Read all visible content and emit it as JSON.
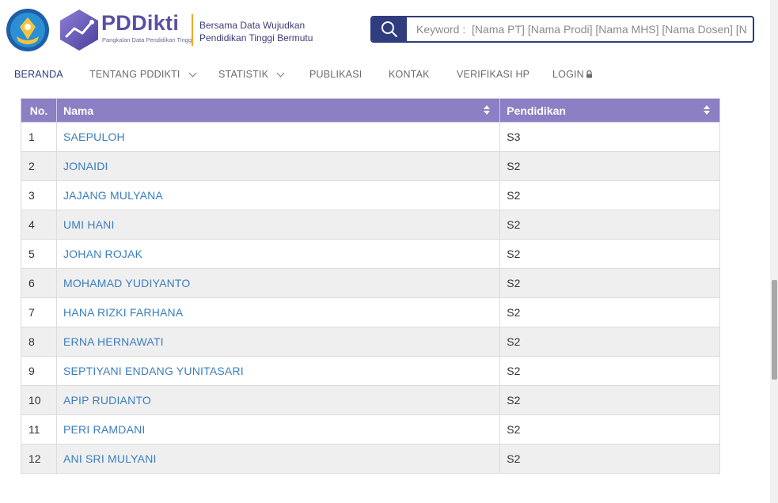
{
  "header": {
    "brand_name": "PDDikti",
    "brand_sub": "Pangkalan Data Pendidikan Tinggi",
    "tagline_line1": "Bersama Data Wujudkan",
    "tagline_line2": "Pendidikan Tinggi Bermutu",
    "search_placeholder": "Keyword :  [Nama PT] [Nama Prodi] [Nama MHS] [Nama Dosen] [N",
    "colors": {
      "brand": "#5a4fa6",
      "search_border": "#2f3c7e",
      "accent": "#f5a623"
    }
  },
  "nav": {
    "items": [
      {
        "label": "BERANDA",
        "icon": null
      },
      {
        "label": "TENTANG PDDIKTI",
        "icon": "chevron-down-icon"
      },
      {
        "label": "STATISTIK",
        "icon": "chevron-down-icon"
      },
      {
        "label": "PUBLIKASI",
        "icon": null
      },
      {
        "label": "KONTAK",
        "icon": null
      },
      {
        "label": "VERIFIKASI HP",
        "icon": null
      },
      {
        "label": "LOGIN",
        "icon": "lock-icon"
      }
    ],
    "active": "BERANDA"
  },
  "table": {
    "headers": {
      "no": "No.",
      "nama": "Nama",
      "pendidikan": "Pendidikan"
    },
    "header_color": "#8c7fc3",
    "link_color": "#3a7ebf",
    "rows": [
      {
        "no": "1",
        "nama": "SAEPULOH",
        "pendidikan": "S3"
      },
      {
        "no": "2",
        "nama": "JONAIDI",
        "pendidikan": "S2"
      },
      {
        "no": "3",
        "nama": "JAJANG MULYANA",
        "pendidikan": "S2"
      },
      {
        "no": "4",
        "nama": "UMI HANI",
        "pendidikan": "S2"
      },
      {
        "no": "5",
        "nama": "JOHAN ROJAK",
        "pendidikan": "S2"
      },
      {
        "no": "6",
        "nama": "MOHAMAD YUDIYANTO",
        "pendidikan": "S2"
      },
      {
        "no": "7",
        "nama": "HANA RIZKI FARHANA",
        "pendidikan": "S2"
      },
      {
        "no": "8",
        "nama": "ERNA HERNAWATI",
        "pendidikan": "S2"
      },
      {
        "no": "9",
        "nama": "SEPTIYANI ENDANG YUNITASARI",
        "pendidikan": "S2"
      },
      {
        "no": "10",
        "nama": "APIP RUDIANTO",
        "pendidikan": "S2"
      },
      {
        "no": "11",
        "nama": "PERI RAMDANI",
        "pendidikan": "S2"
      },
      {
        "no": "12",
        "nama": "ANI SRI MULYANI",
        "pendidikan": "S2"
      }
    ]
  }
}
